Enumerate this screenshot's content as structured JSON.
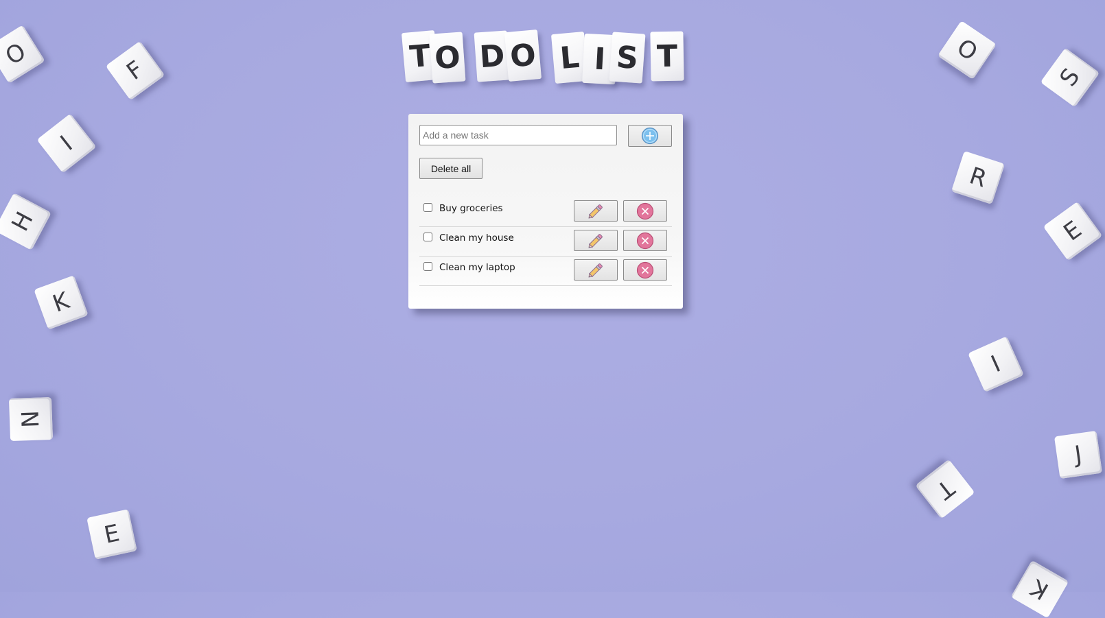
{
  "title": {
    "letters": [
      "T",
      "O",
      "D",
      "O",
      "L",
      "I",
      "S",
      "T"
    ]
  },
  "todo": {
    "input_placeholder": "Add a new task",
    "input_value": "",
    "delete_all_label": "Delete all",
    "tasks": [
      {
        "label": "Buy groceries",
        "done": false
      },
      {
        "label": "Clean my house",
        "done": false
      },
      {
        "label": "Clean my laptop",
        "done": false
      }
    ]
  },
  "background_tiles": [
    "O",
    "F",
    "I",
    "H",
    "K",
    "N",
    "E",
    "O",
    "S",
    "R",
    "E",
    "I",
    "J",
    "T",
    "K"
  ],
  "colors": {
    "background": "#a7a9e0",
    "add_icon": "#7cc0ee",
    "remove_icon": "#e2759b",
    "pencil_body": "#f3c66a"
  }
}
